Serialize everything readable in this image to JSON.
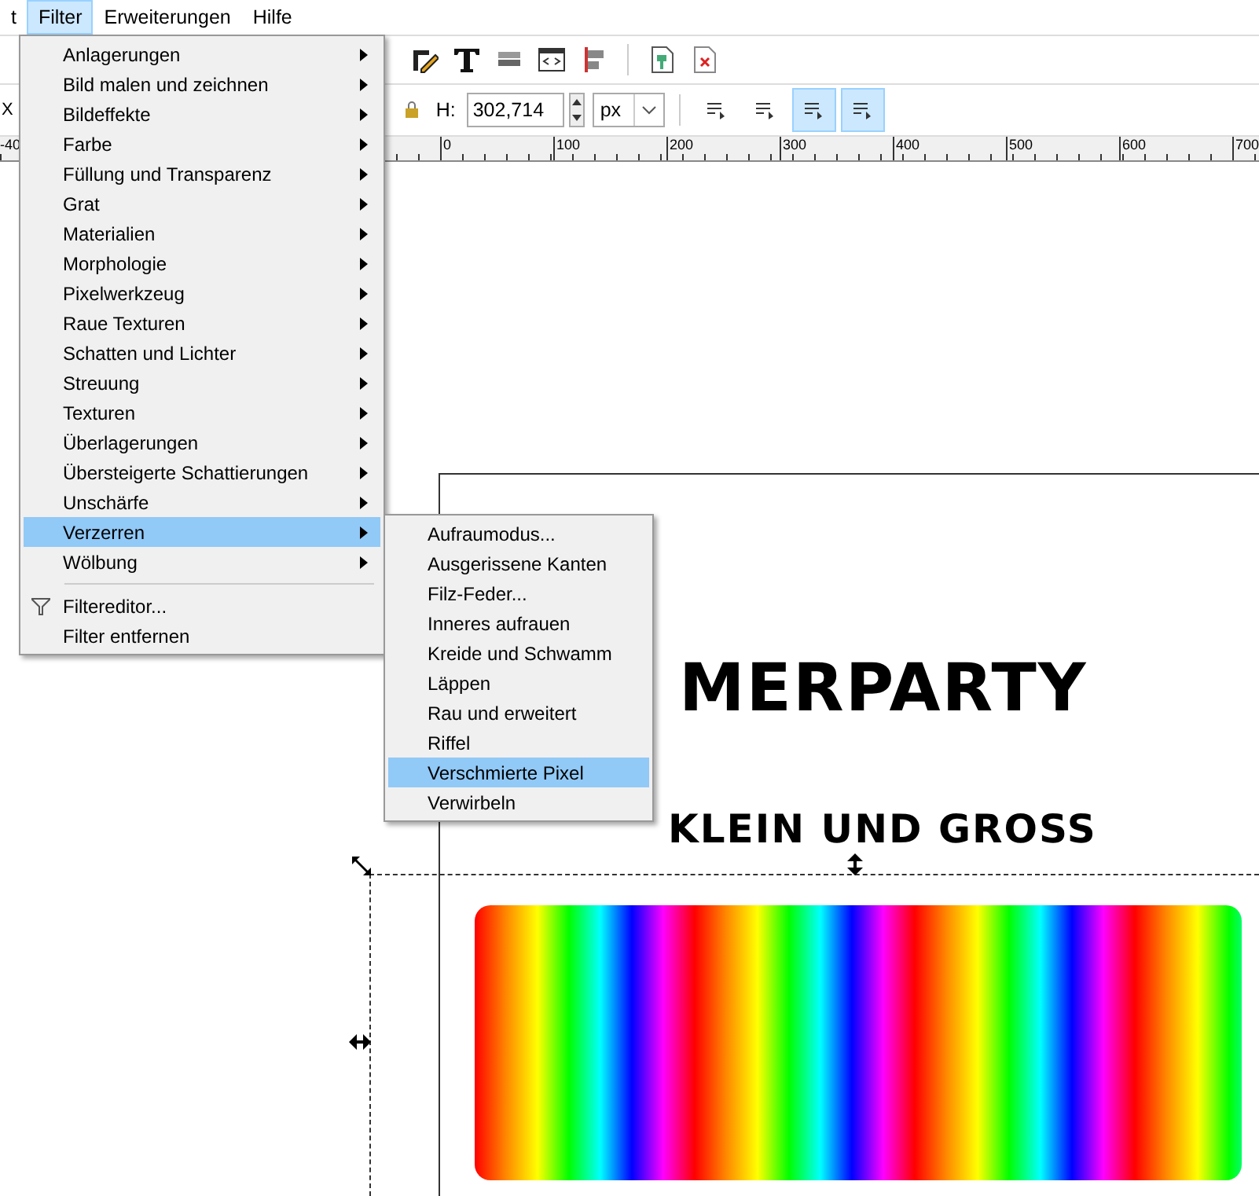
{
  "menubar": [
    {
      "label": "t",
      "selected": false
    },
    {
      "label": "Filter",
      "selected": true
    },
    {
      "label": "Erweiterungen",
      "selected": false
    },
    {
      "label": "Hilfe",
      "selected": false
    }
  ],
  "toolbar": {
    "x_label": "X",
    "height_field": {
      "label": "H:",
      "value": "302,714"
    },
    "unit_select": {
      "value": "px"
    },
    "toggles": [
      {
        "selected": false
      },
      {
        "selected": false
      },
      {
        "selected": true
      },
      {
        "selected": true
      }
    ]
  },
  "ruler": {
    "labels": [
      "-40",
      "0",
      "100",
      "200",
      "300",
      "400",
      "500",
      "600",
      "700"
    ]
  },
  "filter_menu": {
    "items": [
      {
        "kind": "submenu",
        "label": "Anlagerungen",
        "selected": false
      },
      {
        "kind": "submenu",
        "label": "Bild malen und zeichnen",
        "selected": false
      },
      {
        "kind": "submenu",
        "label": "Bildeffekte",
        "selected": false
      },
      {
        "kind": "submenu",
        "label": "Farbe",
        "selected": false
      },
      {
        "kind": "submenu",
        "label": "Füllung und Transparenz",
        "selected": false
      },
      {
        "kind": "submenu",
        "label": "Grat",
        "selected": false
      },
      {
        "kind": "submenu",
        "label": "Materialien",
        "selected": false
      },
      {
        "kind": "submenu",
        "label": "Morphologie",
        "selected": false
      },
      {
        "kind": "submenu",
        "label": "Pixelwerkzeug",
        "selected": false
      },
      {
        "kind": "submenu",
        "label": "Raue Texturen",
        "selected": false
      },
      {
        "kind": "submenu",
        "label": "Schatten und Lichter",
        "selected": false
      },
      {
        "kind": "submenu",
        "label": "Streuung",
        "selected": false
      },
      {
        "kind": "submenu",
        "label": "Texturen",
        "selected": false
      },
      {
        "kind": "submenu",
        "label": "Überlagerungen",
        "selected": false
      },
      {
        "kind": "submenu",
        "label": "Übersteigerte Schattierungen",
        "selected": false
      },
      {
        "kind": "submenu",
        "label": "Unschärfe",
        "selected": false
      },
      {
        "kind": "submenu",
        "label": "Verzerren",
        "selected": true
      },
      {
        "kind": "submenu",
        "label": "Wölbung",
        "selected": false
      },
      {
        "kind": "separator"
      },
      {
        "kind": "icon_action",
        "label": "Filtereditor...",
        "selected": false
      },
      {
        "kind": "action",
        "label": "Filter entfernen",
        "selected": false
      }
    ]
  },
  "distort_submenu": {
    "items": [
      {
        "label": "Aufraumodus...",
        "selected": false
      },
      {
        "label": "Ausgerissene Kanten",
        "selected": false
      },
      {
        "label": "Filz-Feder...",
        "selected": false
      },
      {
        "label": "Inneres aufrauen",
        "selected": false
      },
      {
        "label": "Kreide und Schwamm",
        "selected": false
      },
      {
        "label": "Läppen",
        "selected": false
      },
      {
        "label": "Rau und erweitert",
        "selected": false
      },
      {
        "label": "Riffel",
        "selected": false
      },
      {
        "label": "Verschmierte Pixel",
        "selected": true
      },
      {
        "label": "Verwirbeln",
        "selected": false
      }
    ]
  },
  "canvas": {
    "artwork_lines": [
      "MERPARTY",
      "KLEIN UND GROSS"
    ]
  }
}
